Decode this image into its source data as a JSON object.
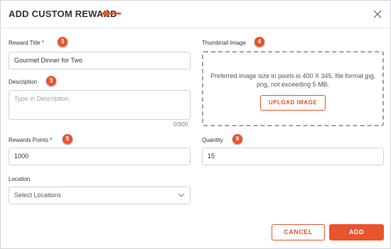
{
  "dialog": {
    "title": "ADD CUSTOM REWARD",
    "close_icon": "close-icon"
  },
  "form": {
    "reward_title": {
      "label": "Reward Title",
      "required_mark": "*",
      "value": "Gourmet Dinner for Two",
      "badge": "3"
    },
    "description": {
      "label": "Description",
      "placeholder": "Type in Description",
      "counter": "0/300",
      "badge": "3"
    },
    "reward_points": {
      "label": "Rewards Points",
      "required_mark": "*",
      "value": "1000",
      "badge": "5"
    },
    "location": {
      "label": "Location",
      "selected": "Select Locations"
    },
    "thumbnail": {
      "label": "Thumbnail Image",
      "badge": "4",
      "hint": "Preferred image size in pixels is 400 X 345, file format jpg, png, not exceeding 5 MB.",
      "upload_label": "UPLOAD IMAGE"
    },
    "quantity": {
      "label": "Quantity",
      "value": "15",
      "badge": "6"
    }
  },
  "footer": {
    "cancel_label": "CANCEL",
    "add_label": "ADD"
  },
  "colors": {
    "accent": "#e9542c",
    "border": "#cfd3d8",
    "text": "#333333"
  }
}
